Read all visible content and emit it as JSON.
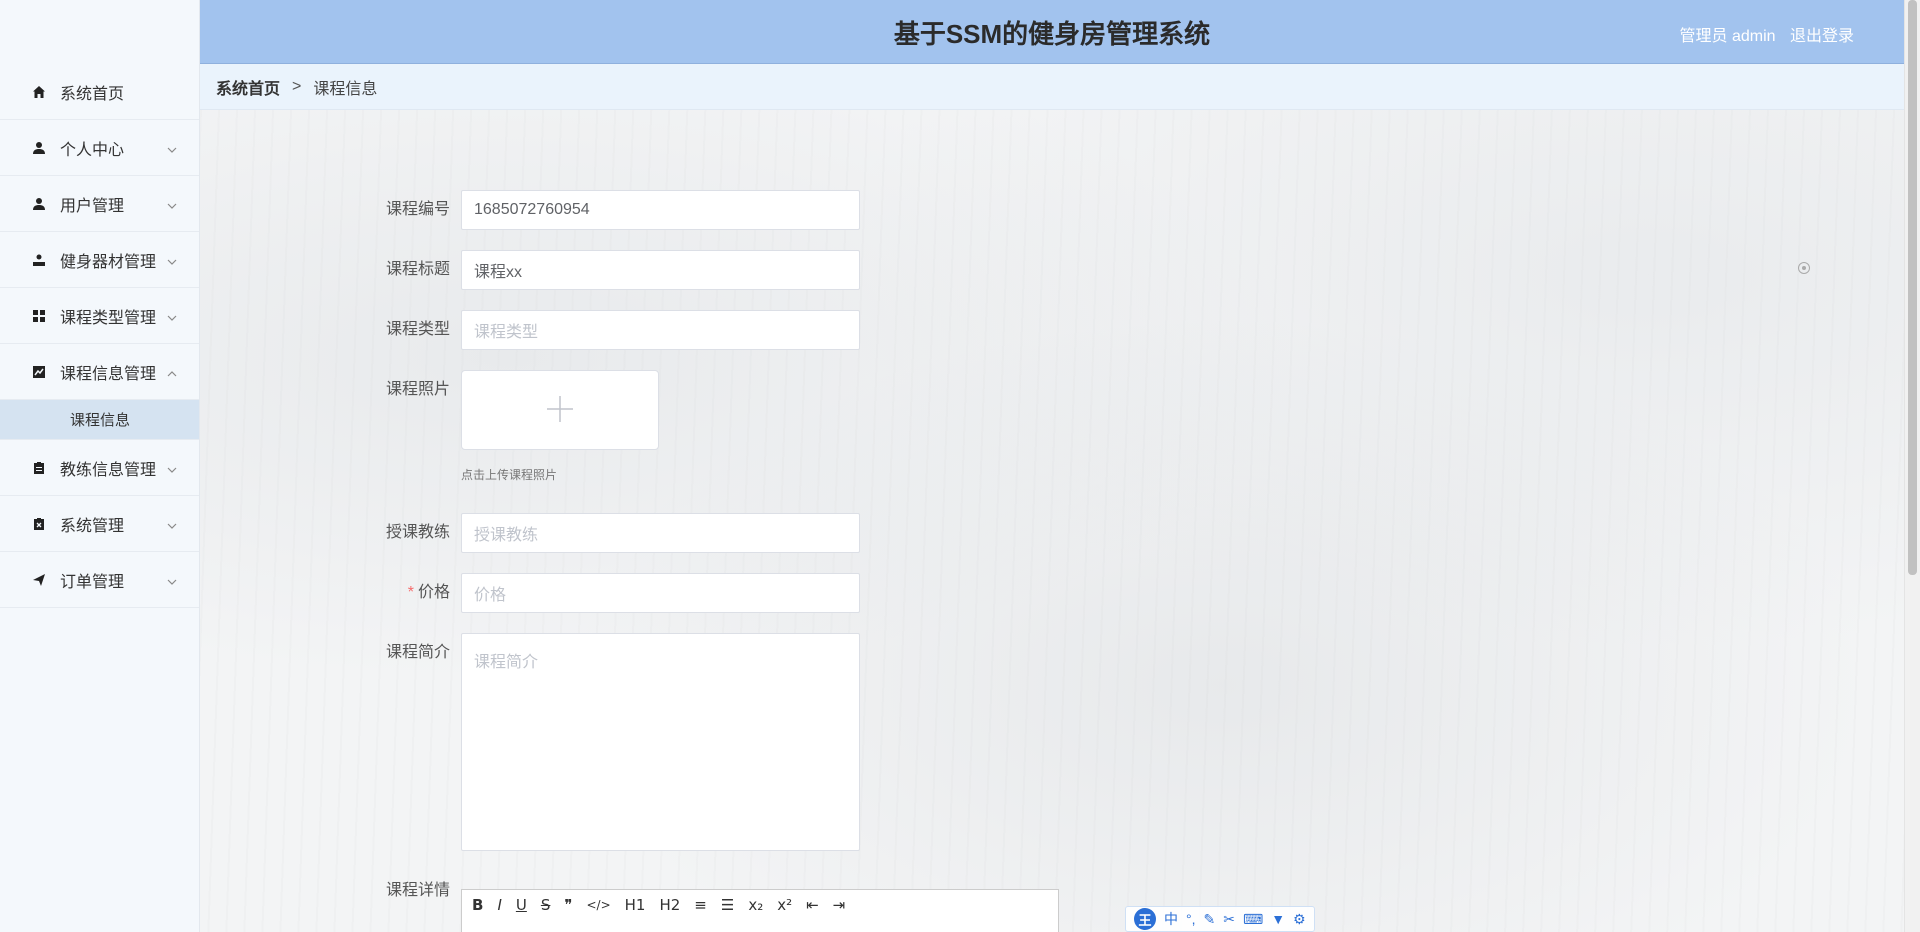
{
  "header": {
    "title": "基于SSM的健身房管理系统",
    "user_label": "管理员 admin",
    "logout": "退出登录"
  },
  "breadcrumb": {
    "home": "系统首页",
    "separator": ">",
    "current": "课程信息"
  },
  "sidebar": {
    "items": [
      {
        "label": "系统首页",
        "icon": "home-icon"
      },
      {
        "label": "个人中心",
        "icon": "user-icon"
      },
      {
        "label": "用户管理",
        "icon": "user-icon"
      },
      {
        "label": "健身器材管理",
        "icon": "dumbbell-icon"
      },
      {
        "label": "课程类型管理",
        "icon": "grid-icon"
      },
      {
        "label": "课程信息管理",
        "icon": "chart-icon"
      },
      {
        "label": "教练信息管理",
        "icon": "clipboard-icon"
      },
      {
        "label": "系统管理",
        "icon": "clipboard-x-icon"
      },
      {
        "label": "订单管理",
        "icon": "send-icon"
      }
    ],
    "sub_item": "课程信息"
  },
  "form": {
    "course_no": {
      "label": "课程编号",
      "value": "1685072760954"
    },
    "course_title": {
      "label": "课程标题",
      "value": "课程xx"
    },
    "course_type": {
      "label": "课程类型",
      "placeholder": "课程类型"
    },
    "course_photo": {
      "label": "课程照片",
      "hint": "点击上传课程照片"
    },
    "coach": {
      "label": "授课教练",
      "placeholder": "授课教练"
    },
    "price": {
      "label": "价格",
      "placeholder": "价格",
      "required_mark": "*"
    },
    "intro": {
      "label": "课程简介",
      "placeholder": "课程简介"
    },
    "detail": {
      "label": "课程详情"
    }
  },
  "editor_toolbar": [
    "B",
    "I",
    "U",
    "S",
    "❞",
    "</>",
    "H1",
    "H2",
    "≡",
    "☰",
    "x₂",
    "x²",
    "⇤",
    "⇥"
  ],
  "ime": {
    "logo": "王",
    "mode": "中"
  },
  "colors": {
    "header_bg": "#a2c3ee",
    "sidebar_bg": "#f4f8fc",
    "active_sub_bg": "#d5e3f1",
    "required": "#f56c6c"
  }
}
